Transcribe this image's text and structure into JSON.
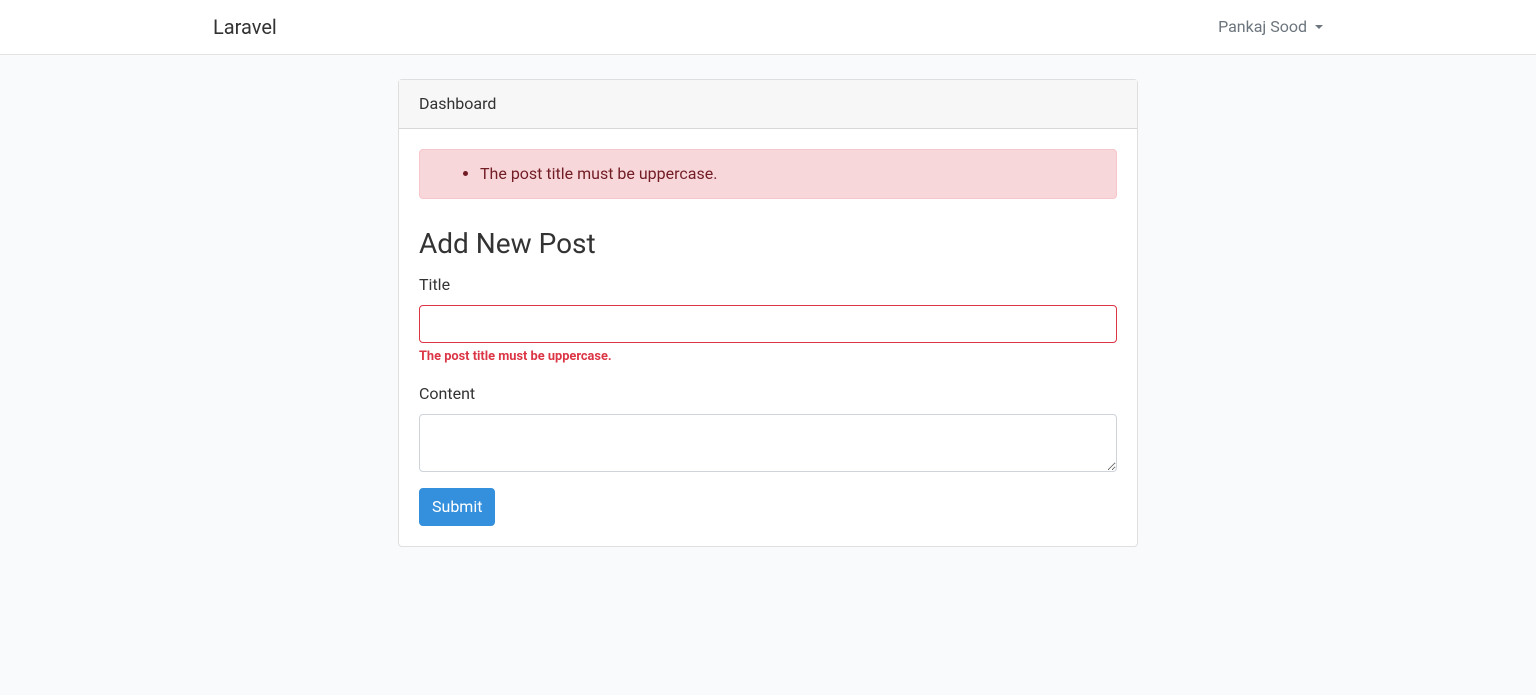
{
  "navbar": {
    "brand": "Laravel",
    "user_name": "Pankaj Sood"
  },
  "card": {
    "header": "Dashboard"
  },
  "alert": {
    "errors": [
      "The post title must be uppercase."
    ]
  },
  "form": {
    "heading": "Add New Post",
    "title_label": "Title",
    "title_value": "",
    "title_error": "The post title must be uppercase.",
    "content_label": "Content",
    "content_value": "",
    "submit_label": "Submit"
  }
}
